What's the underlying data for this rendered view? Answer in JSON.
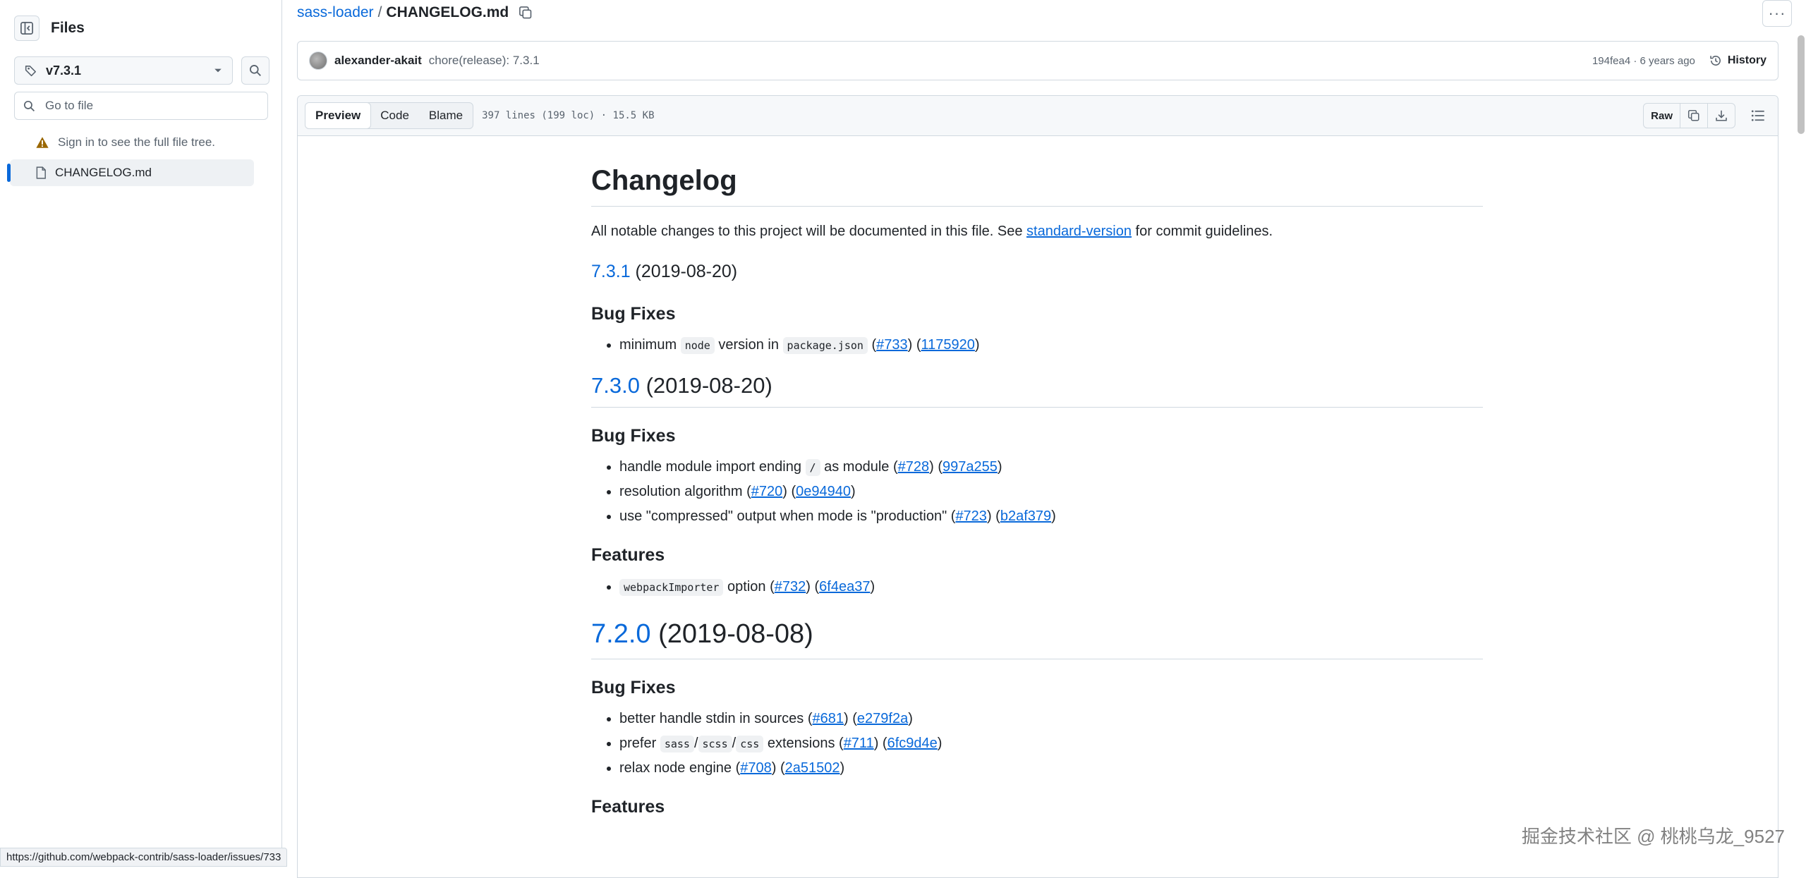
{
  "sidebar": {
    "title": "Files",
    "branch": "v7.3.1",
    "goto_placeholder": "Go to file",
    "signin_notice": "Sign in to see the full file tree.",
    "tree": [
      {
        "label": "CHANGELOG.md",
        "selected": true
      }
    ]
  },
  "breadcrumb": {
    "repo": "sass-loader",
    "separator": "/",
    "file": "CHANGELOG.md"
  },
  "commit": {
    "author": "alexander-akait",
    "message": "chore(release): 7.3.1",
    "sha_time": "194fea4 · 6 years ago",
    "history_label": "History"
  },
  "file_toolbar": {
    "tabs": [
      "Preview",
      "Code",
      "Blame"
    ],
    "active_tab": "Preview",
    "meta": "397 lines (199 loc) · 15.5 KB",
    "raw_label": "Raw"
  },
  "markdown": {
    "title": "Changelog",
    "intro_before": "All notable changes to this project will be documented in this file. See ",
    "intro_link": "standard-version",
    "intro_after": " for commit guidelines.",
    "releases": [
      {
        "version": "7.3.1",
        "date": " (2019-08-20)",
        "bugfix_heading": "Bug Fixes",
        "bugfix_text": "minimum",
        "bugfix_code1": "node",
        "bugfix_mid": "version in",
        "bugfix_code2": "package.json",
        "bugfix_issue": "#733",
        "bugfix_commit": "1175920"
      },
      {
        "version": "7.3.0",
        "date": " (2019-08-20)",
        "bugfix_heading": "Bug Fixes",
        "fixes": [
          {
            "pre": "handle module import ending",
            "code": "/",
            "post": "as module",
            "issue": "#728",
            "commit": "997a255"
          },
          {
            "pre": "resolution algorithm",
            "issue": "#720",
            "commit": "0e94940"
          },
          {
            "pre": "use \"compressed\" output when mode is \"production\"",
            "issue": "#723",
            "commit": "b2af379"
          }
        ],
        "features_heading": "Features",
        "features": [
          {
            "code": "webpackImporter",
            "post": "option",
            "issue": "#732",
            "commit": "6f4ea37"
          }
        ]
      },
      {
        "version": "7.2.0",
        "date": " (2019-08-08)",
        "bugfix_heading": "Bug Fixes",
        "fixes": [
          {
            "pre": "better handle stdin in sources",
            "issue": "#681",
            "commit": "e279f2a"
          },
          {
            "pre": "prefer",
            "code1": "sass",
            "code2": "scss",
            "code3": "css",
            "post": "extensions",
            "issue": "#711",
            "commit": "6fc9d4e"
          },
          {
            "pre": "relax node engine",
            "issue": "#708",
            "commit": "2a51502"
          }
        ],
        "features_heading": "Features"
      }
    ]
  },
  "status_url": "https://github.com/webpack-contrib/sass-loader/issues/733",
  "watermark": "掘金技术社区 @ 桃桃乌龙_9527",
  "colors": {
    "link": "#0969da",
    "border": "#d1d9e0",
    "muted": "#59636e",
    "accent_bar": "#0969da",
    "warning": "#9a6700"
  }
}
